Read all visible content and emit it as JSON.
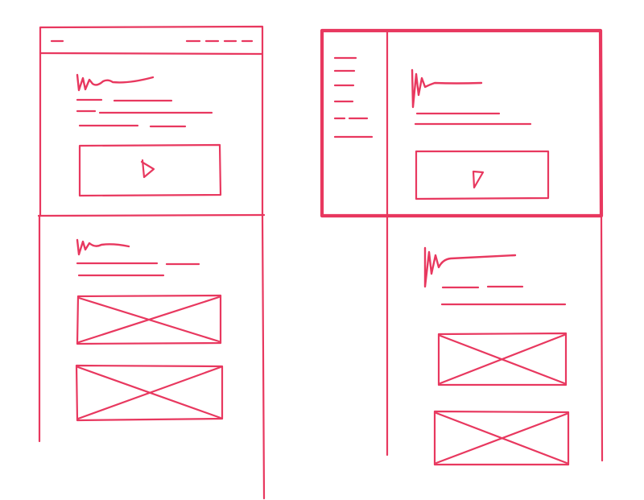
{
  "diagram": {
    "kind": "hand-drawn wireframe sketch",
    "stroke_color": "#e8385f",
    "background_color": "#ffffff",
    "layouts": [
      {
        "id": "left-layout",
        "screens": [
          {
            "id": "landing-screen",
            "elements": [
              "top-nav-bar",
              "nav-logo-dash",
              "nav-links",
              "scribble-heading",
              "text-lines",
              "video-play-button"
            ]
          },
          {
            "id": "content-screen",
            "elements": [
              "scribble-heading",
              "text-lines",
              "image-placeholder",
              "image-placeholder"
            ]
          }
        ]
      },
      {
        "id": "right-layout",
        "screens": [
          {
            "id": "dashboard-screen",
            "emphasis": "bold outline",
            "elements": [
              "sidebar-menu",
              "scribble-heading",
              "text-lines",
              "video-play-button"
            ]
          },
          {
            "id": "content-screen",
            "elements": [
              "scribble-heading",
              "text-lines",
              "image-placeholder",
              "image-placeholder"
            ]
          }
        ]
      }
    ],
    "icons": [
      "play-icon",
      "image-placeholder-icon"
    ]
  }
}
